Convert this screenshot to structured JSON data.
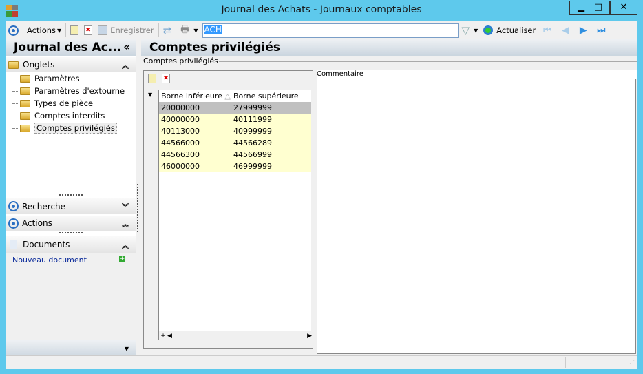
{
  "window": {
    "title": "Journal des Achats -  Journaux comptables",
    "minimize": "▁",
    "maximize": "□",
    "close": "✕"
  },
  "toolbar": {
    "actions_label": "Actions",
    "save_label": "Enregistrer",
    "search_value": "ACH",
    "refresh_label": "Actualiser"
  },
  "left": {
    "title": "Journal des Ac...",
    "collapse": "«",
    "onglets": {
      "label": "Onglets",
      "items": [
        "Paramètres",
        "Paramètres d'extourne",
        "Types de pièce",
        "Comptes interdits",
        "Comptes privilégiés"
      ]
    },
    "recherche": "Recherche",
    "actions": "Actions",
    "documents": "Documents",
    "new_document": "Nouveau document"
  },
  "main": {
    "title": "Comptes privilégiés",
    "group_label": "Comptes privilégiés",
    "comment_label": "Commentaire",
    "columns": [
      "Borne inférieure",
      "Borne supérieure"
    ],
    "rows": [
      [
        "20000000",
        "27999999"
      ],
      [
        "40000000",
        "40111999"
      ],
      [
        "40113000",
        "40999999"
      ],
      [
        "44566000",
        "44566289"
      ],
      [
        "44566300",
        "44566999"
      ],
      [
        "46000000",
        "46999999"
      ]
    ]
  },
  "colors": {
    "border": "#5ec9ec",
    "row_yellow": "#ffffd0",
    "row_selected": "#c0c0c0"
  }
}
